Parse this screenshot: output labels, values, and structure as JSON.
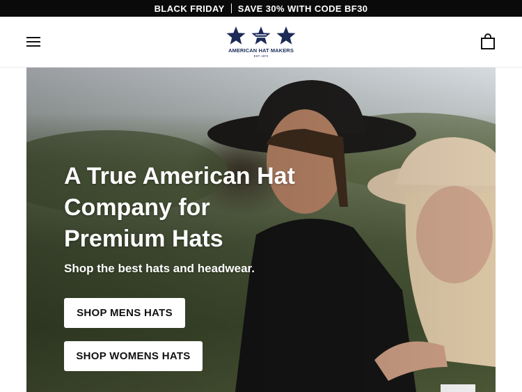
{
  "announcement": {
    "left": "BLACK FRIDAY",
    "right": "SAVE 30% WITH CODE BF30"
  },
  "header": {
    "menu_icon": "hamburger-menu-icon",
    "logo": {
      "name": "AMERICAN HAT MAKERS",
      "est": "EST. 1972",
      "color": "#1b2a57",
      "icon": "three-stars-logo-icon"
    },
    "cart_icon": "shopping-bag-icon"
  },
  "hero": {
    "title_lines": [
      "A True American Hat",
      "Company for",
      "Premium Hats"
    ],
    "subtitle": "Shop the best hats and headwear.",
    "buttons": {
      "mens": "SHOP MENS HATS",
      "womens": "SHOP WOMENS HATS"
    },
    "image": "couple-in-cowboy-hats-photo"
  },
  "colors": {
    "announcement_bg": "#0a0a0a",
    "brand_navy": "#1b2a57",
    "button_bg": "#ffffff"
  }
}
